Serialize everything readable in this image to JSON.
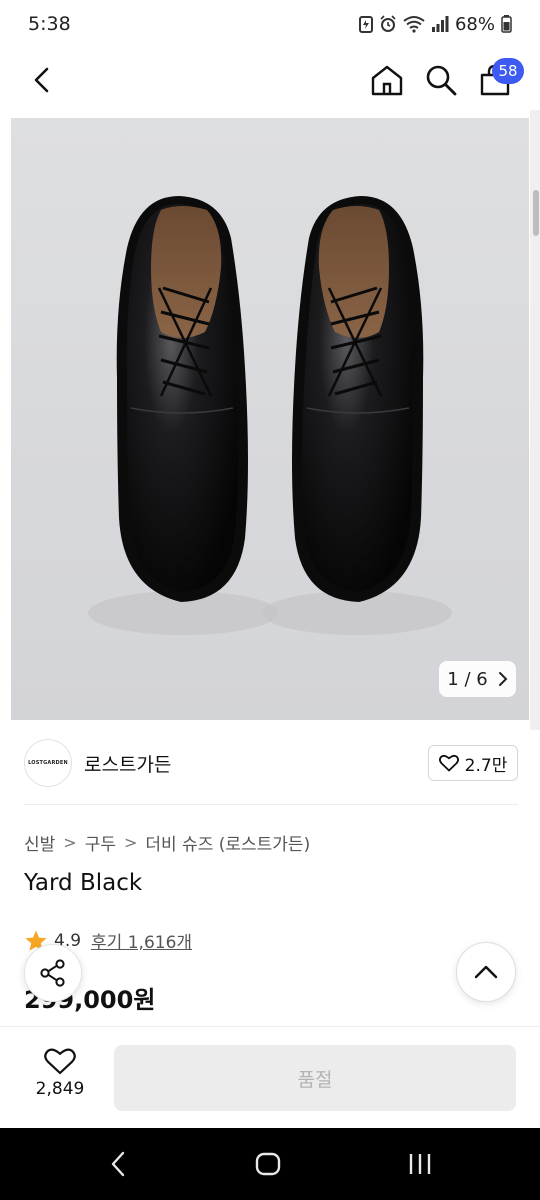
{
  "status_bar": {
    "time": "5:38",
    "battery": "68%"
  },
  "nav": {
    "cart_count": "58"
  },
  "gallery": {
    "counter": "1 / 6"
  },
  "brand": {
    "logo_text": "LOSTGARDEN",
    "name": "로스트가든",
    "likes": "2.7만"
  },
  "breadcrumb": [
    "신발",
    "구두",
    "더비 슈즈 (로스트가든)"
  ],
  "product": {
    "title": "Yard Black",
    "rating": "4.9",
    "reviews": "후기 1,616개",
    "price": "299,000원"
  },
  "bottom": {
    "like_count": "2,849",
    "soldout_label": "품절"
  },
  "colors": {
    "accent": "#3d5af1",
    "star": "#f5a623"
  }
}
